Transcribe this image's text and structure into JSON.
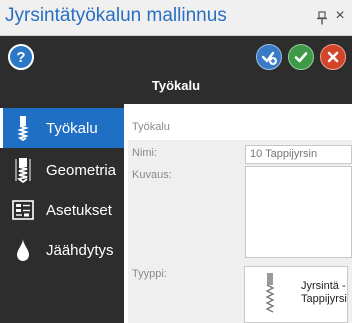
{
  "window": {
    "title": "Jyrsintätyökalun mallinnus",
    "pin_icon": "pin-icon",
    "close_icon": "close-icon"
  },
  "header": {
    "help_icon": "help-icon",
    "help_label": "?",
    "actions": [
      {
        "name": "save-and-new",
        "icon": "save-add-icon",
        "color": "#3a7bc8"
      },
      {
        "name": "ok",
        "icon": "check-icon",
        "color": "#3f9a48"
      },
      {
        "name": "cancel",
        "icon": "x-icon",
        "color": "#d2452a"
      }
    ],
    "section_title": "Työkalu"
  },
  "sidebar": {
    "items": [
      {
        "label": "Työkalu",
        "icon": "tool-icon",
        "active": true
      },
      {
        "label": "Geometria",
        "icon": "geometry-icon",
        "active": false
      },
      {
        "label": "Asetukset",
        "icon": "settings-icon",
        "active": false
      },
      {
        "label": "Jäähdytys",
        "icon": "coolant-drop-icon",
        "active": false
      }
    ],
    "active_color": "#1f6fc4"
  },
  "form": {
    "group_label": "Työkalu",
    "name_label": "Nimi:",
    "name_value": "10 Tappijyrsin",
    "description_label": "Kuvaus:",
    "description_value": "",
    "type_label": "Tyyppi:",
    "type_value_line1": "Jyrsintä -",
    "type_value_line2": "Tappijyrsi",
    "type_icon": "end-mill-icon"
  }
}
